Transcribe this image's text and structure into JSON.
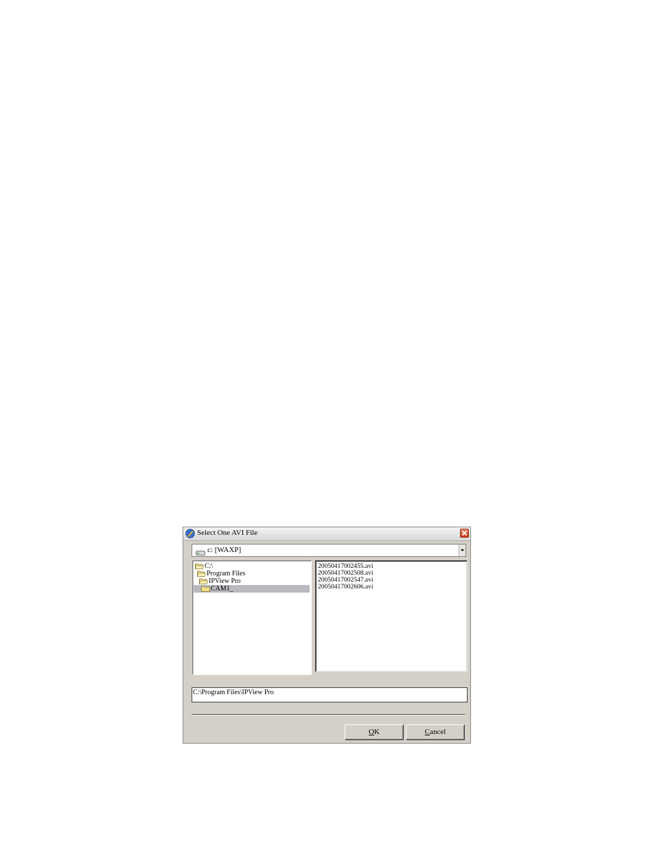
{
  "window": {
    "title": "Select One AVI File",
    "icon": "app-icon",
    "close_icon": "close-icon"
  },
  "drive_combo": {
    "icon": "drive-icon",
    "value": "c: [WAXP]"
  },
  "directories": [
    {
      "label": "C:\\",
      "selected": false
    },
    {
      "label": "Program Files",
      "selected": false
    },
    {
      "label": "IPView Pro",
      "selected": false
    },
    {
      "label": "CAM1_",
      "selected": true
    }
  ],
  "files": [
    "20050417002455.avi",
    "20050417002508.avi",
    "20050417002547.avi",
    "20050417002606.avi"
  ],
  "path": {
    "value": "C:\\Program Files\\IPView Pro"
  },
  "buttons": {
    "ok_mnemonic": "O",
    "ok_rest": "K",
    "cancel_mnemonic": "C",
    "cancel_rest": "ancel"
  },
  "colors": {
    "dialog_bg": "#d4d0c8",
    "selection_bg": "#b9b9bf",
    "close_button": "#d9532b"
  }
}
